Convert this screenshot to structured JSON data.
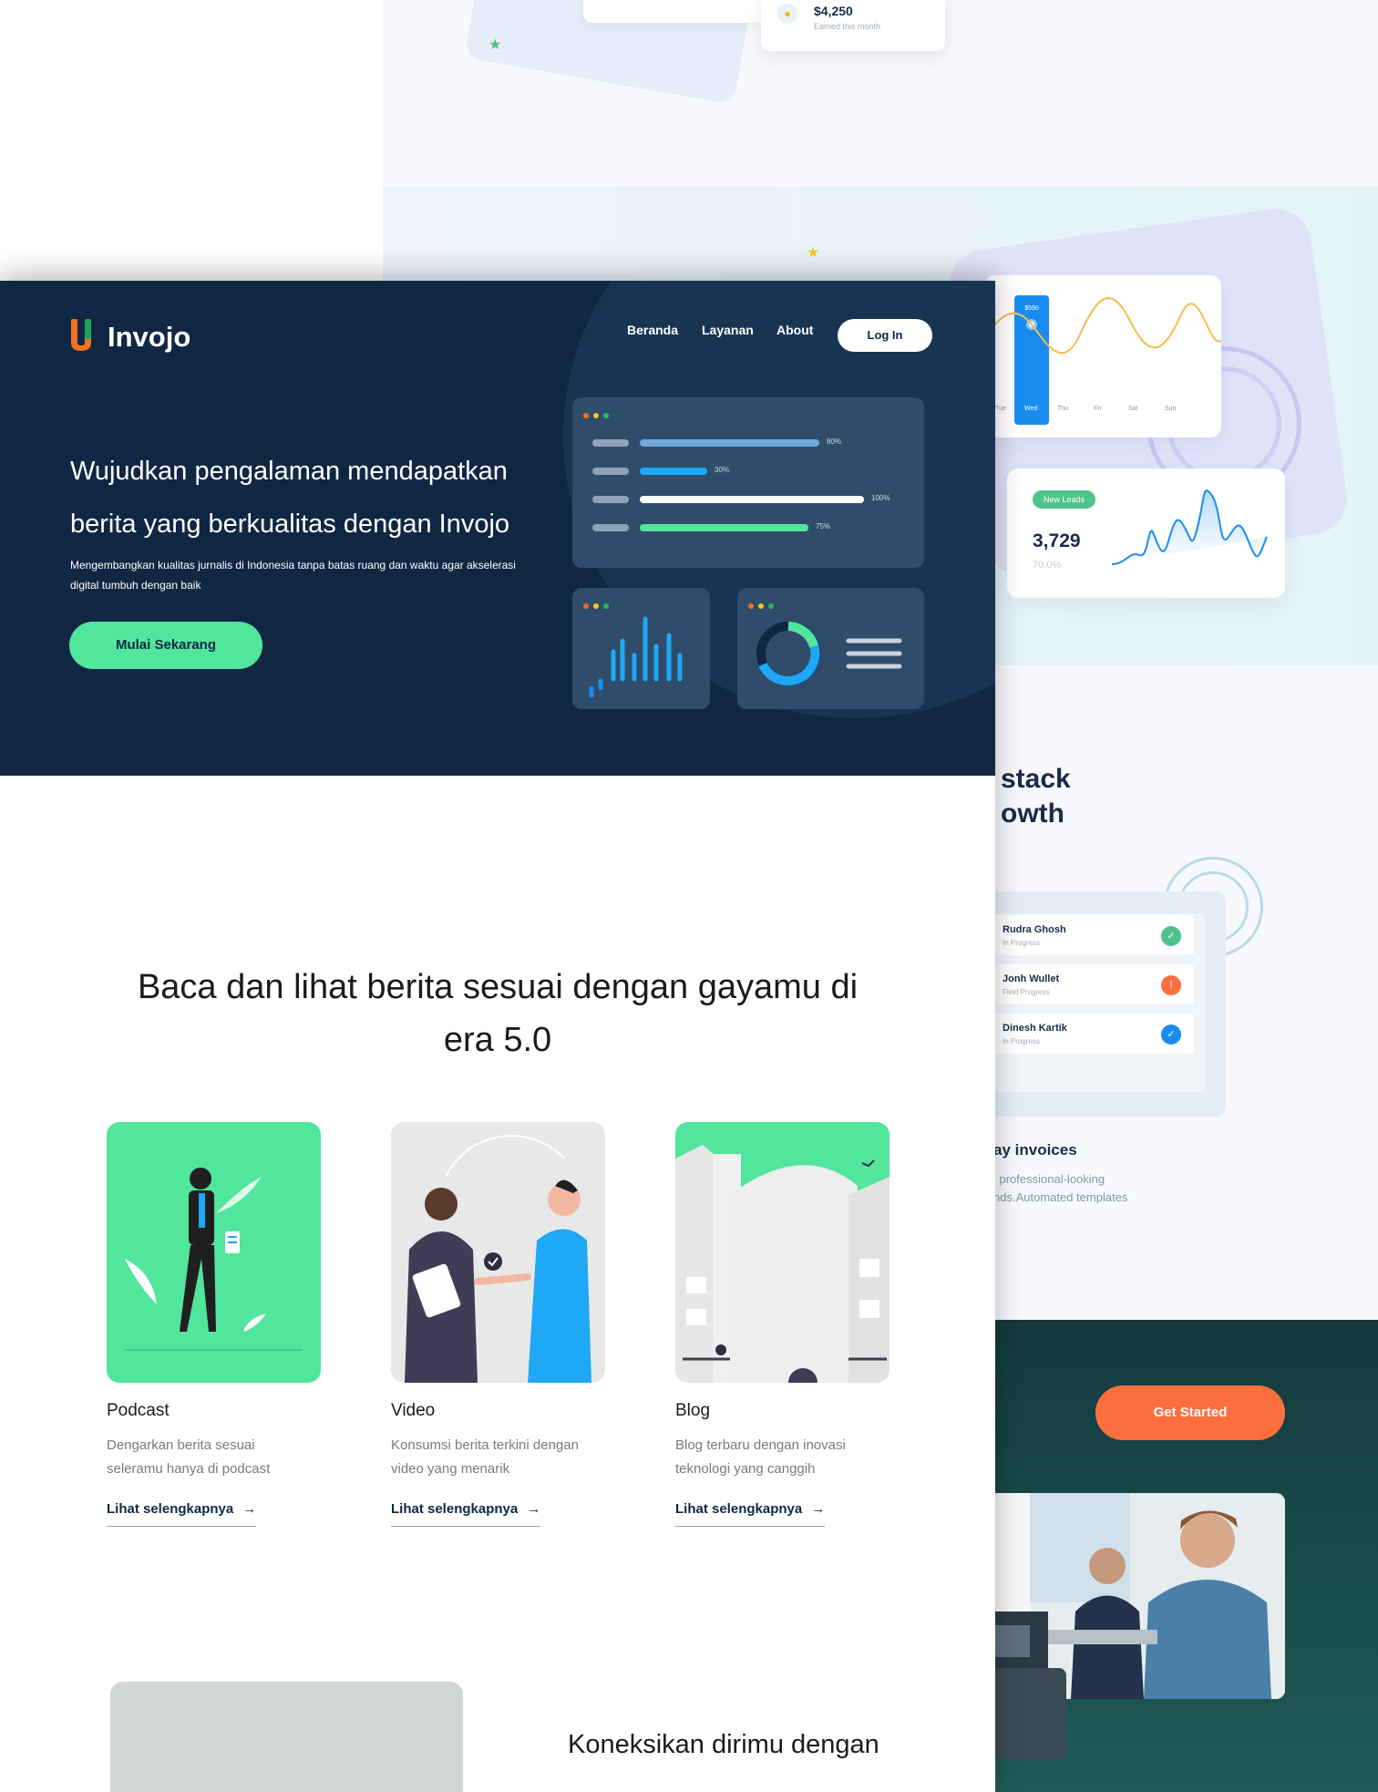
{
  "background": {
    "earnings": {
      "amount": "$4,250",
      "caption": "Earned this month",
      "icon": "coin-icon"
    },
    "chart": {
      "bar_value": "$590",
      "days": [
        "Tue",
        "Wed",
        "Thu",
        "Fri",
        "Sat",
        "Sun"
      ],
      "selected_day": "Wed"
    },
    "leads": {
      "badge": "New Leads",
      "value": "3,729",
      "percent": "70.0%"
    },
    "heading": "stack\nowth",
    "tasks": [
      {
        "name": "Rudra Ghosh",
        "status": "In Progress",
        "icon": "check-icon",
        "color": "#4fc38a"
      },
      {
        "name": "Jonh Wullet",
        "status": "Field Progress",
        "icon": "alert-icon",
        "color": "#fb6f3e"
      },
      {
        "name": "Dinesh Kartik",
        "status": "In Progress",
        "icon": "check-icon",
        "color": "#1a8cf0"
      }
    ],
    "invoices_title": "ay invoices",
    "invoices_desc": "l professional-looking\nnds.Automated templates",
    "cta": "Get Started",
    "accent_colors": {
      "green": "#4fc38a",
      "orange": "#fb6f3e",
      "blue": "#1a8cf0",
      "star_green": "#4fc38a",
      "star_yellow": "#f5c518"
    }
  },
  "header": {
    "logo_text": "Invojo",
    "nav": [
      "Beranda",
      "Layanan",
      "About"
    ],
    "login": "Log In"
  },
  "hero": {
    "title": "Wujudkan pengalaman mendapatkan berita yang berkualitas dengan Invojo",
    "subtitle": "Mengembangkan kualitas jurnalis di Indonesia tanpa batas ruang dan waktu agar akselerasi digital tumbuh dengan baik",
    "cta": "Mulai Sekarang",
    "progress": [
      {
        "label": "80%",
        "value": 0.8,
        "color": "#6fa9dd"
      },
      {
        "label": "30%",
        "value": 0.3,
        "color": "#1ea8f5"
      },
      {
        "label": "100%",
        "value": 1.0,
        "color": "#ffffff"
      },
      {
        "label": "75%",
        "value": 0.75,
        "color": "#52e59c"
      }
    ],
    "colors": {
      "background": "#102744",
      "accent": "#52e59c"
    }
  },
  "services": {
    "title": "Baca dan lihat berita sesuai dengan gayamu di era 5.0",
    "cards": [
      {
        "name": "Podcast",
        "desc": "Dengarkan berita sesuai seleramu hanya di podcast",
        "link": "Lihat selengkapnya",
        "icon": "podcast-illustration"
      },
      {
        "name": "Video",
        "desc": "Konsumsi berita terkini dengan video yang menarik",
        "link": "Lihat selengkapnya",
        "icon": "video-illustration"
      },
      {
        "name": "Blog",
        "desc": "Blog terbaru dengan inovasi teknologi yang canggih",
        "link": "Lihat selengkapnya",
        "icon": "blog-illustration"
      }
    ]
  },
  "connect": {
    "title": "Koneksikan dirimu dengan"
  }
}
